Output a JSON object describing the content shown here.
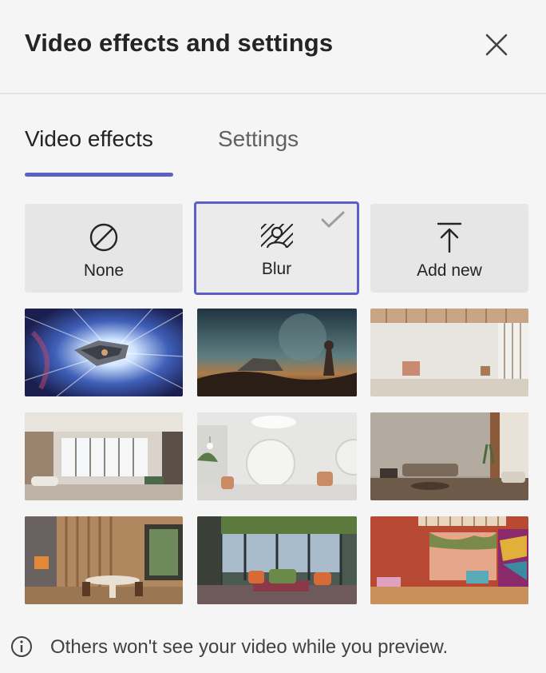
{
  "header": {
    "title": "Video effects and settings"
  },
  "tabs": [
    {
      "label": "Video effects",
      "active": true
    },
    {
      "label": "Settings",
      "active": false
    }
  ],
  "effects": [
    {
      "label": "None",
      "icon": "none-icon"
    },
    {
      "label": "Blur",
      "icon": "blur-icon",
      "selected": true
    },
    {
      "label": "Add new",
      "icon": "upload-icon"
    }
  ],
  "backgrounds": [
    "space-warp",
    "desert-planet",
    "minimal-room",
    "loft-living",
    "white-arches",
    "concrete-lounge",
    "wood-dining",
    "garden-lounge",
    "red-courtyard"
  ],
  "footer": {
    "text": "Others won't see your video while you preview."
  },
  "colors": {
    "accent": "#5b5fc7",
    "background": "#f5f5f5",
    "tile": "#e6e6e6"
  }
}
